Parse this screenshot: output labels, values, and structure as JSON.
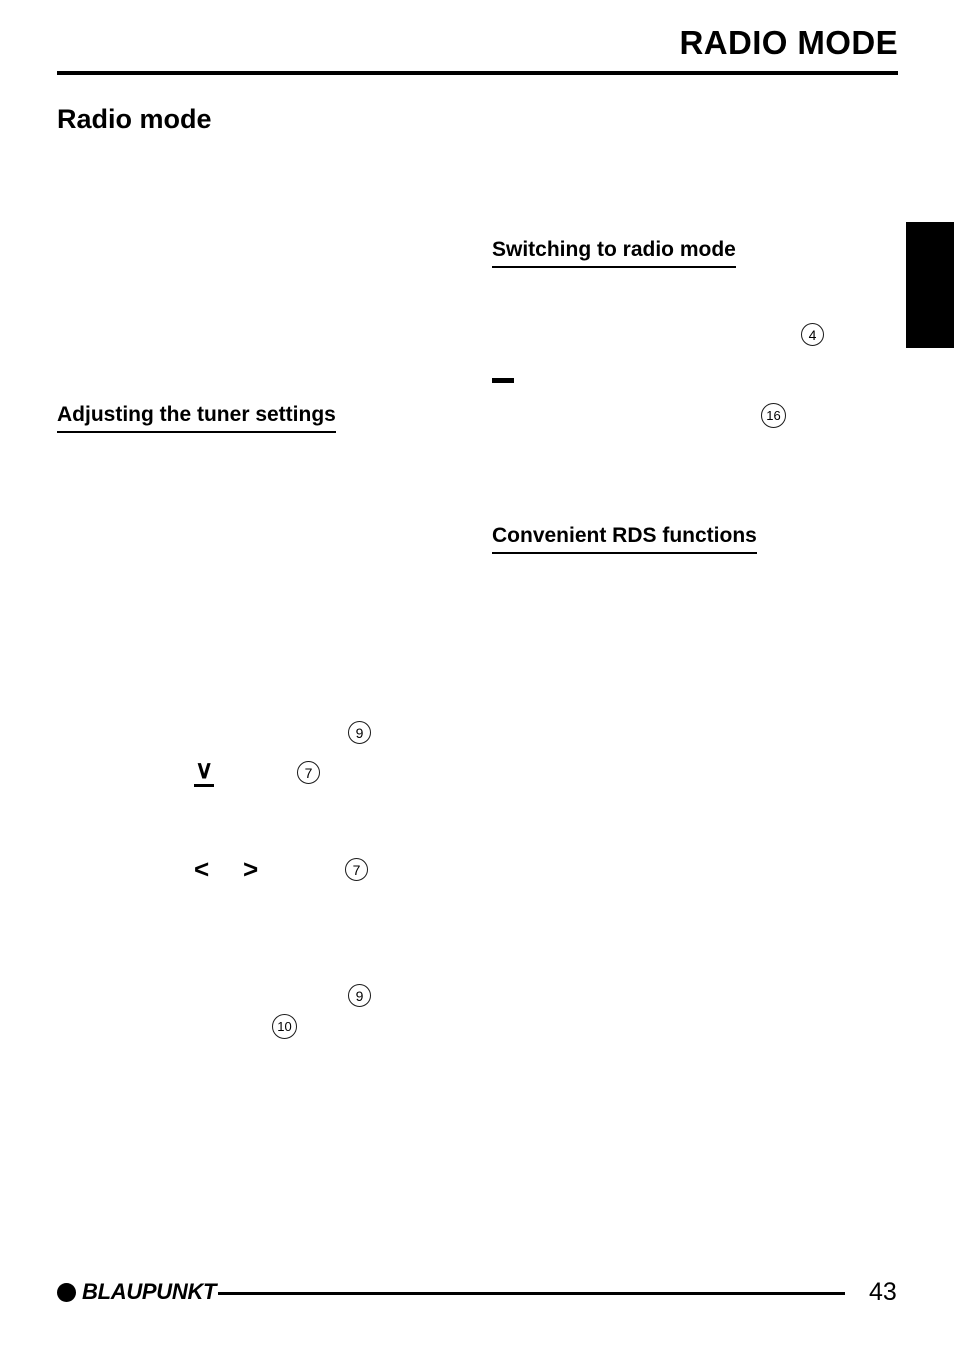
{
  "document": {
    "running_head": "RADIO MODE",
    "chapter_title": "Radio mode",
    "page_number": "43"
  },
  "columns": {
    "left": {
      "headings": [
        {
          "id": "adjusting-tuner-settings",
          "text": "Adjusting the tuner settings"
        }
      ],
      "button_glyphs": [
        {
          "id": "down-button",
          "glyph": "∨",
          "underlined": true
        },
        {
          "id": "left-button",
          "glyph": "<",
          "underlined": false
        },
        {
          "id": "right-button",
          "glyph": ">",
          "underlined": false
        }
      ],
      "references": [
        "9",
        "7",
        "7",
        "9",
        "10"
      ]
    },
    "right": {
      "headings": [
        {
          "id": "switching-to-radio-mode",
          "text": "Switching to radio mode"
        },
        {
          "id": "convenient-rds-functions",
          "text": "Convenient RDS functions"
        }
      ],
      "button_glyphs": [
        {
          "id": "bar-button",
          "glyph": "—",
          "underlined": false
        }
      ],
      "references": [
        "4",
        "16"
      ]
    }
  },
  "references": {
    "r4": "4",
    "r16": "16",
    "r9a": "9",
    "r7a": "7",
    "r7b": "7",
    "r9b": "9",
    "r10": "10"
  },
  "glyphs": {
    "down": "∨",
    "left": "<",
    "right": ">"
  },
  "footer": {
    "brand": "BLAUPUNKT",
    "page": "43"
  },
  "colors": {
    "ink": "#000000",
    "paper": "#ffffff",
    "tab": "#000000"
  }
}
